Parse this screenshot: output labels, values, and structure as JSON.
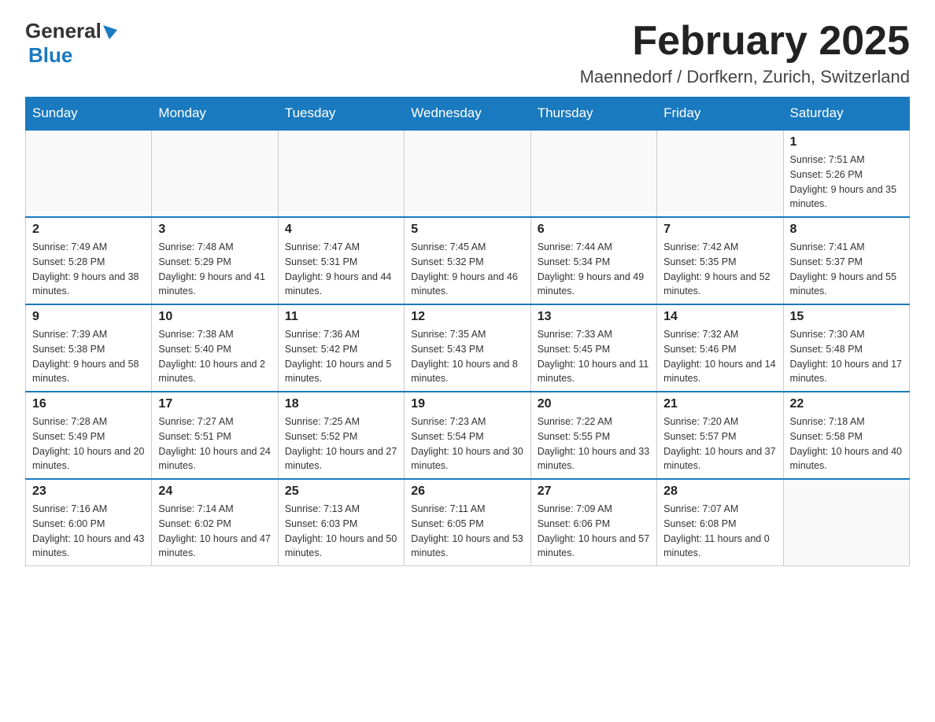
{
  "header": {
    "month_title": "February 2025",
    "location": "Maennedorf / Dorfkern, Zurich, Switzerland"
  },
  "days_of_week": [
    "Sunday",
    "Monday",
    "Tuesday",
    "Wednesday",
    "Thursday",
    "Friday",
    "Saturday"
  ],
  "weeks": [
    [
      {
        "day": "",
        "sunrise": "",
        "sunset": "",
        "daylight": "",
        "empty": true
      },
      {
        "day": "",
        "sunrise": "",
        "sunset": "",
        "daylight": "",
        "empty": true
      },
      {
        "day": "",
        "sunrise": "",
        "sunset": "",
        "daylight": "",
        "empty": true
      },
      {
        "day": "",
        "sunrise": "",
        "sunset": "",
        "daylight": "",
        "empty": true
      },
      {
        "day": "",
        "sunrise": "",
        "sunset": "",
        "daylight": "",
        "empty": true
      },
      {
        "day": "",
        "sunrise": "",
        "sunset": "",
        "daylight": "",
        "empty": true
      },
      {
        "day": "1",
        "sunrise": "Sunrise: 7:51 AM",
        "sunset": "Sunset: 5:26 PM",
        "daylight": "Daylight: 9 hours and 35 minutes.",
        "empty": false
      }
    ],
    [
      {
        "day": "2",
        "sunrise": "Sunrise: 7:49 AM",
        "sunset": "Sunset: 5:28 PM",
        "daylight": "Daylight: 9 hours and 38 minutes.",
        "empty": false
      },
      {
        "day": "3",
        "sunrise": "Sunrise: 7:48 AM",
        "sunset": "Sunset: 5:29 PM",
        "daylight": "Daylight: 9 hours and 41 minutes.",
        "empty": false
      },
      {
        "day": "4",
        "sunrise": "Sunrise: 7:47 AM",
        "sunset": "Sunset: 5:31 PM",
        "daylight": "Daylight: 9 hours and 44 minutes.",
        "empty": false
      },
      {
        "day": "5",
        "sunrise": "Sunrise: 7:45 AM",
        "sunset": "Sunset: 5:32 PM",
        "daylight": "Daylight: 9 hours and 46 minutes.",
        "empty": false
      },
      {
        "day": "6",
        "sunrise": "Sunrise: 7:44 AM",
        "sunset": "Sunset: 5:34 PM",
        "daylight": "Daylight: 9 hours and 49 minutes.",
        "empty": false
      },
      {
        "day": "7",
        "sunrise": "Sunrise: 7:42 AM",
        "sunset": "Sunset: 5:35 PM",
        "daylight": "Daylight: 9 hours and 52 minutes.",
        "empty": false
      },
      {
        "day": "8",
        "sunrise": "Sunrise: 7:41 AM",
        "sunset": "Sunset: 5:37 PM",
        "daylight": "Daylight: 9 hours and 55 minutes.",
        "empty": false
      }
    ],
    [
      {
        "day": "9",
        "sunrise": "Sunrise: 7:39 AM",
        "sunset": "Sunset: 5:38 PM",
        "daylight": "Daylight: 9 hours and 58 minutes.",
        "empty": false
      },
      {
        "day": "10",
        "sunrise": "Sunrise: 7:38 AM",
        "sunset": "Sunset: 5:40 PM",
        "daylight": "Daylight: 10 hours and 2 minutes.",
        "empty": false
      },
      {
        "day": "11",
        "sunrise": "Sunrise: 7:36 AM",
        "sunset": "Sunset: 5:42 PM",
        "daylight": "Daylight: 10 hours and 5 minutes.",
        "empty": false
      },
      {
        "day": "12",
        "sunrise": "Sunrise: 7:35 AM",
        "sunset": "Sunset: 5:43 PM",
        "daylight": "Daylight: 10 hours and 8 minutes.",
        "empty": false
      },
      {
        "day": "13",
        "sunrise": "Sunrise: 7:33 AM",
        "sunset": "Sunset: 5:45 PM",
        "daylight": "Daylight: 10 hours and 11 minutes.",
        "empty": false
      },
      {
        "day": "14",
        "sunrise": "Sunrise: 7:32 AM",
        "sunset": "Sunset: 5:46 PM",
        "daylight": "Daylight: 10 hours and 14 minutes.",
        "empty": false
      },
      {
        "day": "15",
        "sunrise": "Sunrise: 7:30 AM",
        "sunset": "Sunset: 5:48 PM",
        "daylight": "Daylight: 10 hours and 17 minutes.",
        "empty": false
      }
    ],
    [
      {
        "day": "16",
        "sunrise": "Sunrise: 7:28 AM",
        "sunset": "Sunset: 5:49 PM",
        "daylight": "Daylight: 10 hours and 20 minutes.",
        "empty": false
      },
      {
        "day": "17",
        "sunrise": "Sunrise: 7:27 AM",
        "sunset": "Sunset: 5:51 PM",
        "daylight": "Daylight: 10 hours and 24 minutes.",
        "empty": false
      },
      {
        "day": "18",
        "sunrise": "Sunrise: 7:25 AM",
        "sunset": "Sunset: 5:52 PM",
        "daylight": "Daylight: 10 hours and 27 minutes.",
        "empty": false
      },
      {
        "day": "19",
        "sunrise": "Sunrise: 7:23 AM",
        "sunset": "Sunset: 5:54 PM",
        "daylight": "Daylight: 10 hours and 30 minutes.",
        "empty": false
      },
      {
        "day": "20",
        "sunrise": "Sunrise: 7:22 AM",
        "sunset": "Sunset: 5:55 PM",
        "daylight": "Daylight: 10 hours and 33 minutes.",
        "empty": false
      },
      {
        "day": "21",
        "sunrise": "Sunrise: 7:20 AM",
        "sunset": "Sunset: 5:57 PM",
        "daylight": "Daylight: 10 hours and 37 minutes.",
        "empty": false
      },
      {
        "day": "22",
        "sunrise": "Sunrise: 7:18 AM",
        "sunset": "Sunset: 5:58 PM",
        "daylight": "Daylight: 10 hours and 40 minutes.",
        "empty": false
      }
    ],
    [
      {
        "day": "23",
        "sunrise": "Sunrise: 7:16 AM",
        "sunset": "Sunset: 6:00 PM",
        "daylight": "Daylight: 10 hours and 43 minutes.",
        "empty": false
      },
      {
        "day": "24",
        "sunrise": "Sunrise: 7:14 AM",
        "sunset": "Sunset: 6:02 PM",
        "daylight": "Daylight: 10 hours and 47 minutes.",
        "empty": false
      },
      {
        "day": "25",
        "sunrise": "Sunrise: 7:13 AM",
        "sunset": "Sunset: 6:03 PM",
        "daylight": "Daylight: 10 hours and 50 minutes.",
        "empty": false
      },
      {
        "day": "26",
        "sunrise": "Sunrise: 7:11 AM",
        "sunset": "Sunset: 6:05 PM",
        "daylight": "Daylight: 10 hours and 53 minutes.",
        "empty": false
      },
      {
        "day": "27",
        "sunrise": "Sunrise: 7:09 AM",
        "sunset": "Sunset: 6:06 PM",
        "daylight": "Daylight: 10 hours and 57 minutes.",
        "empty": false
      },
      {
        "day": "28",
        "sunrise": "Sunrise: 7:07 AM",
        "sunset": "Sunset: 6:08 PM",
        "daylight": "Daylight: 11 hours and 0 minutes.",
        "empty": false
      },
      {
        "day": "",
        "sunrise": "",
        "sunset": "",
        "daylight": "",
        "empty": true
      }
    ]
  ]
}
